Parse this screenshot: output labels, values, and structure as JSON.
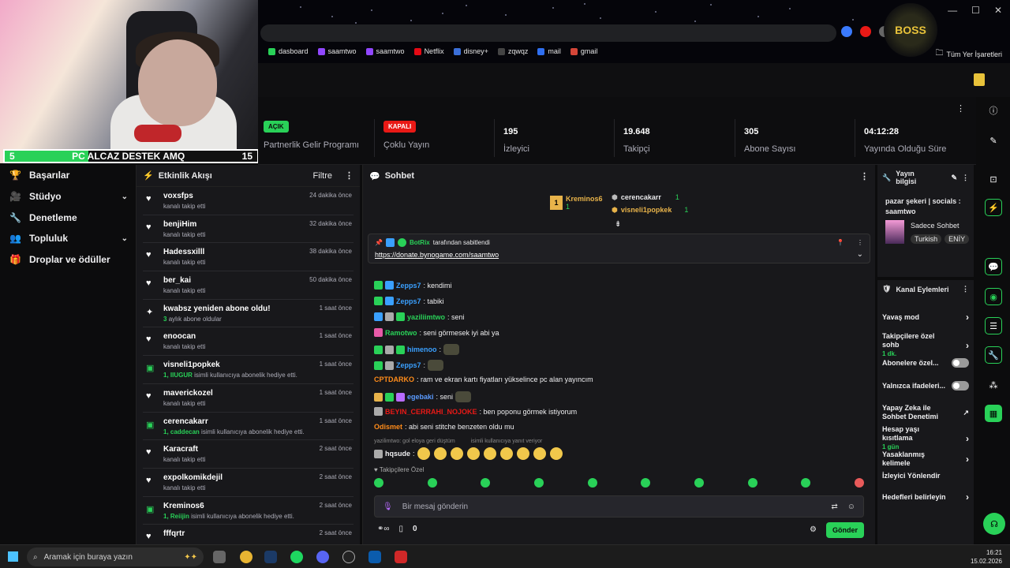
{
  "browser": {
    "bookmarks": [
      {
        "label": "dasboard",
        "color": "#29d158"
      },
      {
        "label": "saamtwo",
        "color": "#9147ff"
      },
      {
        "label": "saamtwo",
        "color": "#9147ff"
      },
      {
        "label": "Netflix",
        "color": "#e50914"
      },
      {
        "label": "disney+",
        "color": "#3b6fd8"
      },
      {
        "label": "zqwqz",
        "color": "#444"
      },
      {
        "label": "mail",
        "color": "#2f6ff0"
      },
      {
        "label": "gmail",
        "color": "#d44638"
      }
    ],
    "all_bookmarks": "Tüm Yer İşaretleri"
  },
  "overlay": {
    "goal_left": "5",
    "goal_text": "PC ALCAZ DESTEK AMQ",
    "goal_right": "15",
    "goal_fraction": 0.33
  },
  "stats": [
    {
      "badge": "AÇIK",
      "badge_color": "#29d158",
      "label": "Partnerlik Gelir Programı"
    },
    {
      "badge": "KAPALI",
      "badge_color": "#e91916",
      "label": "Çoklu Yayın"
    },
    {
      "value": "195",
      "label": "İzleyici"
    },
    {
      "value": "19.648",
      "label": "Takipçi"
    },
    {
      "value": "305",
      "label": "Abone Sayısı"
    },
    {
      "value": "04:12:28",
      "label": "Yayında Olduğu Süre"
    }
  ],
  "leftnav": [
    {
      "label": "Başarılar",
      "icon": "trophy-icon"
    },
    {
      "label": "Stüdyo",
      "icon": "studio-icon",
      "expand": true
    },
    {
      "label": "Denetleme",
      "icon": "wrench-icon"
    },
    {
      "label": "Topluluk",
      "icon": "community-icon",
      "expand": true
    },
    {
      "label": "Droplar ve ödüller",
      "icon": "gift-icon"
    }
  ],
  "activity": {
    "title": "Etkinlik Akışı",
    "filter": "Filtre",
    "rows": [
      {
        "name": "voxsfps",
        "sub": "kanalı takip etti",
        "time": "24 dakika önce",
        "icon": "heart"
      },
      {
        "name": "benjiHim",
        "sub": "kanalı takip etti",
        "time": "32 dakika önce",
        "icon": "heart"
      },
      {
        "name": "Hadessxilll",
        "sub": "kanalı takip etti",
        "time": "38 dakika önce",
        "icon": "heart"
      },
      {
        "name": "ber_kai",
        "sub": "kanalı takip etti",
        "time": "50 dakika önce",
        "icon": "heart"
      },
      {
        "name": "kwabsz yeniden abone oldu!",
        "sub_b": "3",
        "sub": "aylık abone oldular",
        "time": "1 saat önce",
        "icon": "star"
      },
      {
        "name": "enoocan",
        "sub": "kanalı takip etti",
        "time": "1 saat önce",
        "icon": "heart"
      },
      {
        "name": "visneli1popkek",
        "sub_b": "1, IIUGUR",
        "sub": "isimli kullanıcıya abonelik hediye etti.",
        "time": "1 saat önce",
        "icon": "gift"
      },
      {
        "name": "maverickozel",
        "sub": "kanalı takip etti",
        "time": "1 saat önce",
        "icon": "heart"
      },
      {
        "name": "cerencakarr",
        "sub_b": "1, caddecan",
        "sub": "isimli kullanıcıya abonelik hediye etti.",
        "time": "1 saat önce",
        "icon": "gift"
      },
      {
        "name": "Karacraft",
        "sub": "kanalı takip etti",
        "time": "2 saat önce",
        "icon": "heart"
      },
      {
        "name": "expolkomikdejil",
        "sub": "kanalı takip etti",
        "time": "2 saat önce",
        "icon": "heart"
      },
      {
        "name": "Kreminos6",
        "sub_b": "1, Reiijin",
        "sub": "isimli kullanıcıya abonelik hediye etti.",
        "time": "2 saat önce",
        "icon": "gift"
      },
      {
        "name": "fffqrtr",
        "sub": "",
        "time": "2 saat önce",
        "icon": "heart"
      }
    ]
  },
  "chat": {
    "title": "Sohbet",
    "leaders": [
      {
        "name": "Kreminos6",
        "count": "1",
        "rank": "1",
        "color": "#e8b34a"
      },
      {
        "name": "cerencakarr",
        "count": "1",
        "color": "#efeff1"
      },
      {
        "name": "visneli1popkek",
        "count": "1",
        "color": "#e8b34a"
      }
    ],
    "pinned_by": "BotRix",
    "pinned_suffix": "tarafından sabitlendi",
    "pinned_link": "https://donate.bynogame.com/saamtwo",
    "messages": [
      {
        "user": "Zepps7",
        "color": "#3aa0ff",
        "text": ": kendimi"
      },
      {
        "user": "Zepps7",
        "color": "#3aa0ff",
        "text": ": tabiki"
      },
      {
        "user": "yaziliimtwo",
        "color": "#29d158",
        "text": ": seni"
      },
      {
        "user": "Ramotwo",
        "color": "#29d158",
        "text": ": seni görmesek iyi abi ya"
      },
      {
        "user": "himenoo",
        "color": "#3aa0ff",
        "text": ":"
      },
      {
        "user": "Zepps7",
        "color": "#3aa0ff",
        "text": ":"
      },
      {
        "user": "CPTDARKO",
        "color": "#ff8c1a",
        "text": ": ram ve ekran kartı fiyatları yükselince pc alan yayıncım"
      },
      {
        "user": "egebaki",
        "color": "#5a9bff",
        "text": ": seni"
      },
      {
        "user": "BEYIN_CERRAHI_NOJOKE",
        "color": "#e91916",
        "text": ": ben poponu görmek istiyorum"
      },
      {
        "user": "Odismet",
        "color": "#ff8c1a",
        "text": ": abi seni stitche benzeten oldu mu"
      },
      {
        "user": "hqsude",
        "color": "#efeff1",
        "text": ":"
      }
    ],
    "reply_hint": "yazilimtwo: gol eloya geri düştüm",
    "reply_hint2": "isimli kullanıcıya yanıt veriyor",
    "follower_label": "Takipçilere Özel",
    "placeholder": "Bir mesaj gönderin",
    "points": "0",
    "send": "Gönder"
  },
  "stream_info": {
    "title": "Yayın bilgisi",
    "name": "pazar şekeri | socials : saamtwo",
    "category": "Sadece Sohbet",
    "tags": [
      "Turkish",
      "ENİY"
    ]
  },
  "channel_actions": {
    "title": "Kanal Eylemleri",
    "items": [
      {
        "label": "Yavaş mod",
        "kind": "arrow"
      },
      {
        "label": "Takipçilere özel sohb",
        "sub": "1 dk.",
        "kind": "arrow"
      },
      {
        "label": "Abonelere özel...",
        "kind": "toggle"
      },
      {
        "label": "Yalnızca ifadeleri...",
        "kind": "toggle"
      },
      {
        "label": "Yapay Zeka ile Sohbet Denetimi",
        "kind": "link"
      },
      {
        "label": "Hesap yaşı kısıtlama",
        "sub": "1 gün",
        "kind": "arrow"
      },
      {
        "label": "Yasaklanmış kelimele",
        "kind": "arrow"
      },
      {
        "label": "İzleyici Yönlendir",
        "kind": "none"
      },
      {
        "label": "Hedefleri belirleyin",
        "kind": "arrow"
      }
    ]
  },
  "taskbar": {
    "search": "Aramak için buraya yazın",
    "time": "16:21",
    "date": "15.02.2026"
  }
}
